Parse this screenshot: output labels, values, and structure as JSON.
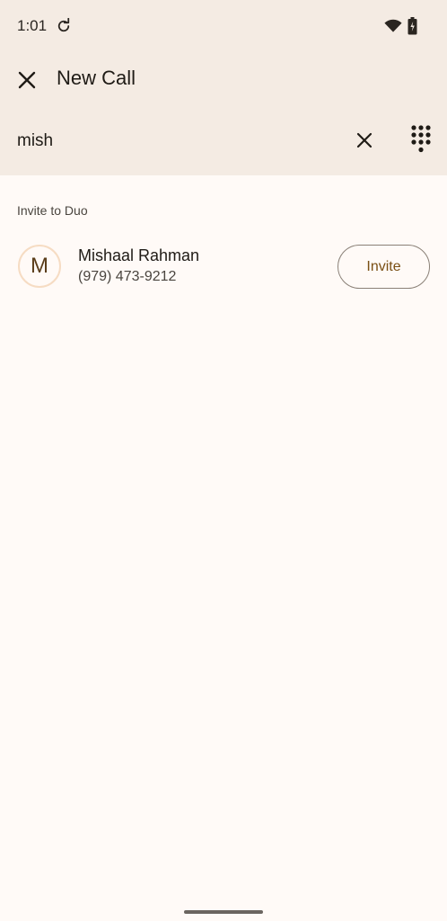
{
  "status_bar": {
    "time": "1:01",
    "icons": [
      "sync-icon",
      "wifi-icon",
      "battery-icon"
    ]
  },
  "toolbar": {
    "close_icon": "close-icon",
    "title": "New Call"
  },
  "search": {
    "value": "mish",
    "clear_icon": "close-icon",
    "dialpad_icon": "dialpad-icon"
  },
  "results": {
    "section_title": "Invite to Duo",
    "contacts": [
      {
        "avatar_letter": "M",
        "name": "Mishaal Rahman",
        "phone": "(979) 473-9212",
        "action_label": "Invite"
      }
    ]
  },
  "colors": {
    "header_bg": "#f4ebe3",
    "page_bg": "#fffaf7",
    "accent": "#7a4f14",
    "avatar_ring": "#f6dcc3"
  }
}
